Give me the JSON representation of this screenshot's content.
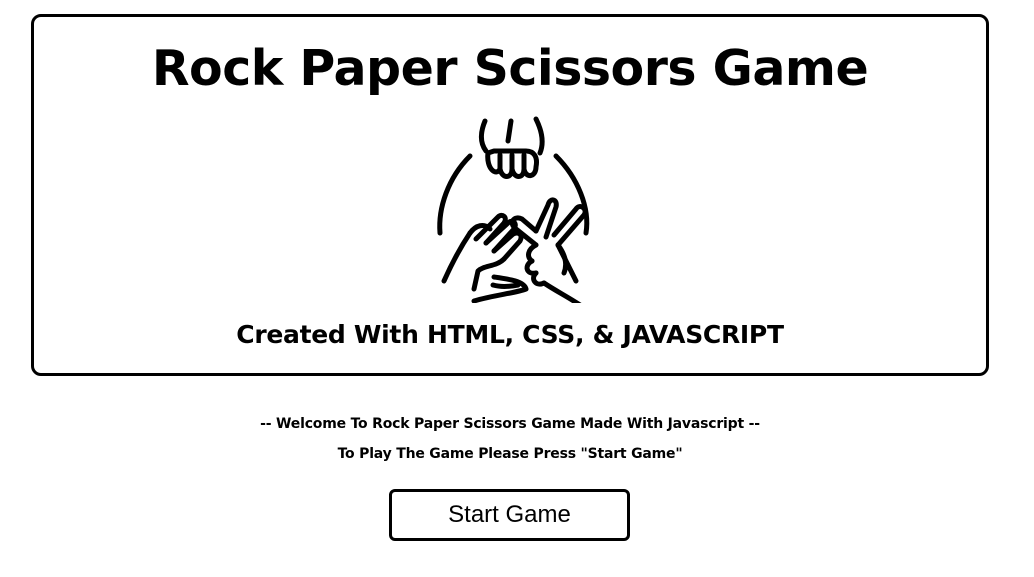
{
  "hero": {
    "title": "Rock Paper Scissors Game",
    "art_icon": "rock-paper-scissors-hands-icon",
    "subtitle": "Created With HTML, CSS, & JAVASCRIPT"
  },
  "intro": {
    "line1": "-- Welcome To Rock Paper Scissors Game Made With Javascript --",
    "line2": "To Play The Game Please Press \"Start Game\""
  },
  "actions": {
    "start_label": "Start Game"
  },
  "colors": {
    "foreground": "#000000",
    "background": "#ffffff"
  }
}
